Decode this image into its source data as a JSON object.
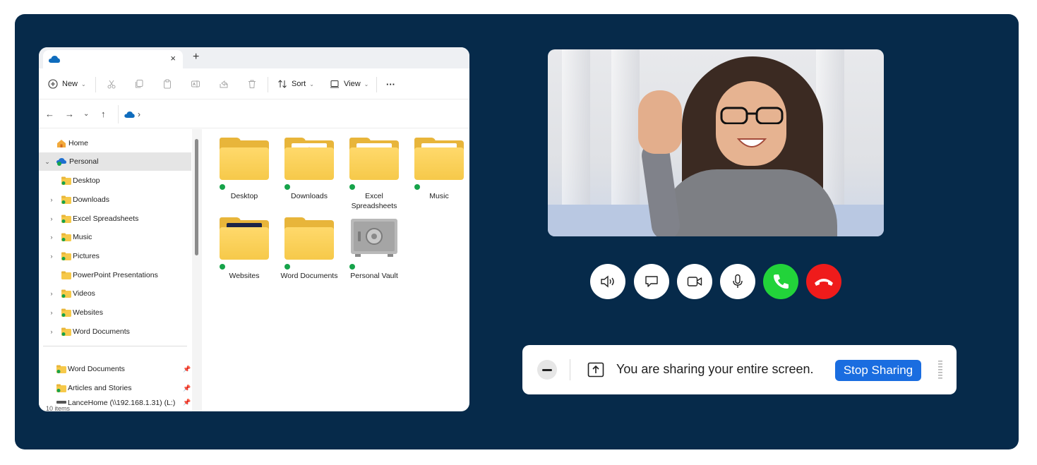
{
  "explorer": {
    "tab_close": "×",
    "new_tab": "+",
    "toolbar": {
      "new_label": "New",
      "sort_label": "Sort",
      "view_label": "View",
      "more_label": "···"
    },
    "address": {
      "separator": "›"
    },
    "sidebar": {
      "items": [
        {
          "label": "Home"
        },
        {
          "label": "Personal"
        },
        {
          "label": "Desktop"
        },
        {
          "label": "Downloads"
        },
        {
          "label": "Excel Spreadsheets"
        },
        {
          "label": "Music"
        },
        {
          "label": "Pictures"
        },
        {
          "label": "PowerPoint Presentations"
        },
        {
          "label": "Videos"
        },
        {
          "label": "Websites"
        },
        {
          "label": "Word Documents"
        }
      ],
      "pinned": [
        {
          "label": "Word Documents"
        },
        {
          "label": "Articles and Stories"
        },
        {
          "label": "LanceHome (\\\\192.168.1.31) (L:)"
        }
      ]
    },
    "status": "10 items",
    "tiles": [
      {
        "label": "Desktop"
      },
      {
        "label": "Downloads"
      },
      {
        "label": "Excel Spreadsheets"
      },
      {
        "label": "Music"
      },
      {
        "label": "Websites"
      },
      {
        "label": "Word Documents"
      },
      {
        "label": "Personal Vault"
      }
    ]
  },
  "share": {
    "message": "You are sharing your entire screen.",
    "stop_label": "Stop Sharing"
  },
  "colors": {
    "background": "#062a4a",
    "accept": "#22d33a",
    "end": "#ef1b1b",
    "stop_button": "#1a6de0"
  }
}
